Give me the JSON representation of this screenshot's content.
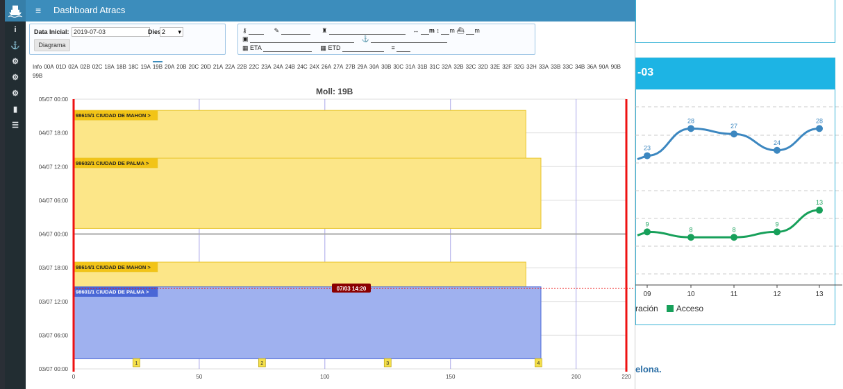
{
  "app": {
    "title": "Dashboard Atracs"
  },
  "sidebar": {
    "icons": [
      "info-icon",
      "ship-icon",
      "cogs-icon",
      "cogs-icon",
      "cogs-icon",
      "stats-icon",
      "list-icon"
    ]
  },
  "filters": {
    "start_label": "Data Inicial:",
    "start_value": "2019-07-03",
    "days_label": "Dies",
    "days_value": "2",
    "button_label": "Diagrama"
  },
  "vessel_fields": {
    "length_unit": "m",
    "beam_unit": "m",
    "draft_unit": "m",
    "eta_label": "ETA",
    "etd_label": "ETD"
  },
  "tabs": [
    "Info",
    "00A",
    "01D",
    "02A",
    "02B",
    "02C",
    "18A",
    "18B",
    "18C",
    "19A",
    "19B",
    "20A",
    "20B",
    "20C",
    "20D",
    "21A",
    "22A",
    "22B",
    "22C",
    "23A",
    "24A",
    "24B",
    "24C",
    "24X",
    "26A",
    "27A",
    "27B",
    "29A",
    "30A",
    "30B",
    "30C",
    "31A",
    "31B",
    "31C",
    "32A",
    "32B",
    "32C",
    "32D",
    "32E",
    "32F",
    "32G",
    "32H",
    "33A",
    "33B",
    "33C",
    "34B",
    "36A",
    "90A",
    "90B",
    "99B"
  ],
  "active_tab": "19B",
  "gantt": {
    "title": "Moll: 19B",
    "y_labels": [
      "05/07 00:00",
      "04/07 18:00",
      "04/07 12:00",
      "04/07 06:00",
      "04/07 00:00",
      "03/07 18:00",
      "03/07 12:00",
      "03/07 06:00",
      "03/07 00:00"
    ],
    "x_ticks": [
      "0",
      "50",
      "100",
      "150",
      "200",
      "220"
    ],
    "x_range": [
      0,
      220
    ],
    "time_range_hours": [
      0,
      48
    ],
    "bars": [
      {
        "label": "98615/1 CIUDAD DE MAHON >",
        "x_start": 0,
        "x_end": 180,
        "t_start_h": 37,
        "t_end_h": 46,
        "color": "#fce688",
        "border": "#e8c42a",
        "label_bg": "#f2c417"
      },
      {
        "label": "98602/1 CIUDAD DE PALMA >",
        "x_start": 0,
        "x_end": 186,
        "t_start_h": 25,
        "t_end_h": 37.5,
        "color": "#fce688",
        "border": "#e8c42a",
        "label_bg": "#f2c417"
      },
      {
        "label": "98614/1 CIUDAD DE MAHON >",
        "x_start": 0,
        "x_end": 180,
        "t_start_h": 13,
        "t_end_h": 19,
        "color": "#fce688",
        "border": "#e8c42a",
        "label_bg": "#f2c417"
      },
      {
        "label": "98601/1 CIUDAD DE PALMA >",
        "x_start": 0,
        "x_end": 186,
        "t_start_h": 1.8,
        "t_end_h": 14.6,
        "color": "#9fb1ef",
        "border": "#4a67d6",
        "label_bg": "#4a67d6"
      }
    ],
    "now_marker": {
      "label": "07/03 14:20",
      "t_h": 14.33
    },
    "day_separator_h": 24,
    "markers": [
      {
        "label": "1",
        "x": 25
      },
      {
        "label": "2",
        "x": 75
      },
      {
        "label": "3",
        "x": 125
      },
      {
        "label": "4",
        "x": 185
      }
    ]
  },
  "background": {
    "card_title": "-03",
    "footer_text": "elona.",
    "legend_left": "ración",
    "legend_item": "Acceso"
  },
  "chart_data": {
    "type": "line",
    "categories": [
      "09",
      "10",
      "11",
      "12",
      "13"
    ],
    "series": [
      {
        "values": [
          23,
          28,
          27,
          24,
          28
        ],
        "color": "#3c87c0"
      },
      {
        "name": "Acceso",
        "values": [
          9,
          8,
          8,
          9,
          13
        ],
        "color": "#17a05a"
      }
    ]
  }
}
